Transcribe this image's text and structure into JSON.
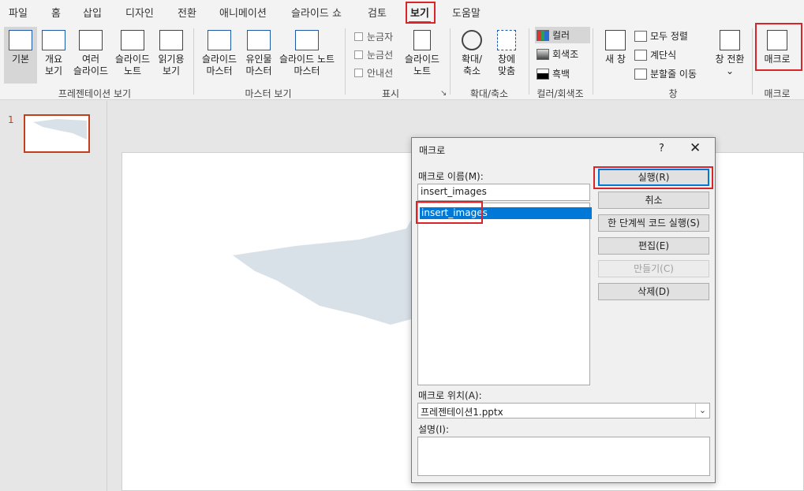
{
  "menu": {
    "tabs": [
      "파일",
      "홈",
      "삽입",
      "디자인",
      "전환",
      "애니메이션",
      "슬라이드 쇼",
      "검토",
      "보기",
      "도움말"
    ],
    "active": "보기"
  },
  "ribbon": {
    "presentation_views": {
      "buttons": [
        [
          "기본"
        ],
        [
          "개요",
          "보기"
        ],
        [
          "여러",
          "슬라이드"
        ],
        [
          "슬라이드",
          "노트"
        ],
        [
          "읽기용",
          "보기"
        ]
      ],
      "label": "프레젠테이션 보기"
    },
    "master_views": {
      "buttons": [
        [
          "슬라이드",
          "마스터"
        ],
        [
          "유인물",
          "마스터"
        ],
        [
          "슬라이드 노트",
          "마스터"
        ]
      ],
      "label": "마스터 보기"
    },
    "show": {
      "checks": [
        "눈금자",
        "눈금선",
        "안내선"
      ],
      "notes_button": [
        "슬라이드",
        "노트"
      ],
      "label": "표시"
    },
    "zoom": {
      "buttons": [
        [
          "확대/",
          "축소"
        ],
        [
          "창에",
          "맞춤"
        ]
      ],
      "label": "확대/축소"
    },
    "color": {
      "items": [
        "컬러",
        "회색조",
        "흑백"
      ],
      "label": "컬러/회색조",
      "swatch_colors": [
        "#2e9e4d",
        "#777777",
        "#111111"
      ]
    },
    "window": {
      "new_window": [
        "새 창"
      ],
      "items": [
        "모두 정렬",
        "계단식",
        "분할줄 이동"
      ],
      "switch": [
        "창 전환",
        "⌄"
      ],
      "label": "창"
    },
    "macro": {
      "button": "매크로",
      "label": "매크로"
    }
  },
  "thumbnails": {
    "number": "1"
  },
  "dialog": {
    "title": "매크로",
    "help": "?",
    "close": "✕",
    "name_label": "매크로 이름(M):",
    "name_value": "insert_images",
    "list_items": [
      "insert_images"
    ],
    "buttons": {
      "run": "실행(R)",
      "cancel": "취소",
      "step": "한 단계씩 코드 실행(S)",
      "edit": "편집(E)",
      "create": "만들기(C)",
      "delete": "삭제(D)"
    },
    "location_label": "매크로 위치(A):",
    "location_value": "프레젠테이션1.pptx",
    "description_label": "설명(I):",
    "description_value": ""
  }
}
